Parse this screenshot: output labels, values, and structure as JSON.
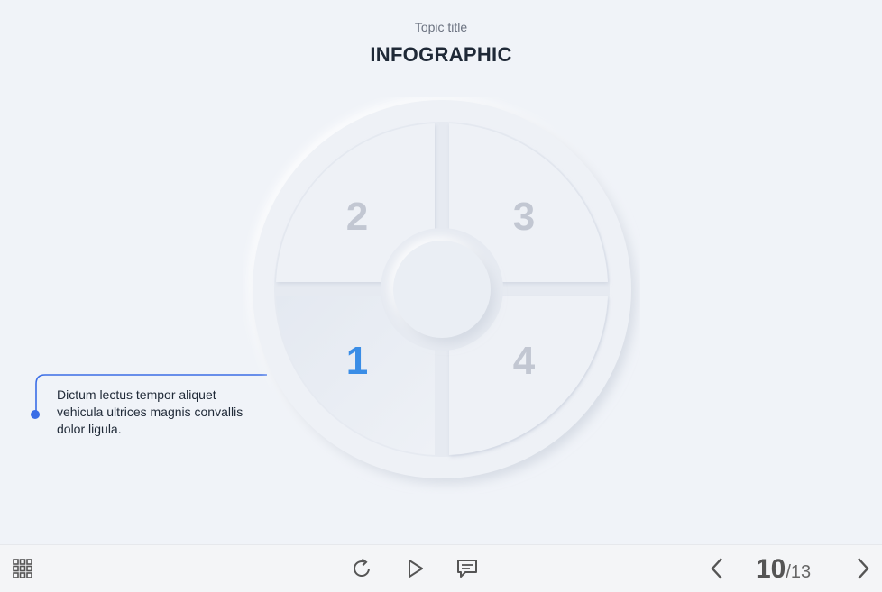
{
  "header": {
    "subtitle": "Topic title",
    "title": "INFOGRAPHIC"
  },
  "infographic": {
    "segments": [
      {
        "number": "1",
        "active": true
      },
      {
        "number": "2",
        "active": false
      },
      {
        "number": "3",
        "active": false
      },
      {
        "number": "4",
        "active": false
      }
    ],
    "callout_text": "Dictum lectus tempor aliquet vehicula ultrices magnis convallis dolor ligula."
  },
  "player": {
    "menu_icon": "grid-icon",
    "replay_icon": "replay-icon",
    "play_icon": "play-icon",
    "notes_icon": "comment-icon",
    "prev_icon": "chevron-left-icon",
    "next_icon": "chevron-right-icon",
    "page_current": "10",
    "page_total": "/13"
  },
  "colors": {
    "accent": "#3a8de6",
    "background": "#f0f3f8",
    "inactive_number": "#c2c7d2"
  }
}
